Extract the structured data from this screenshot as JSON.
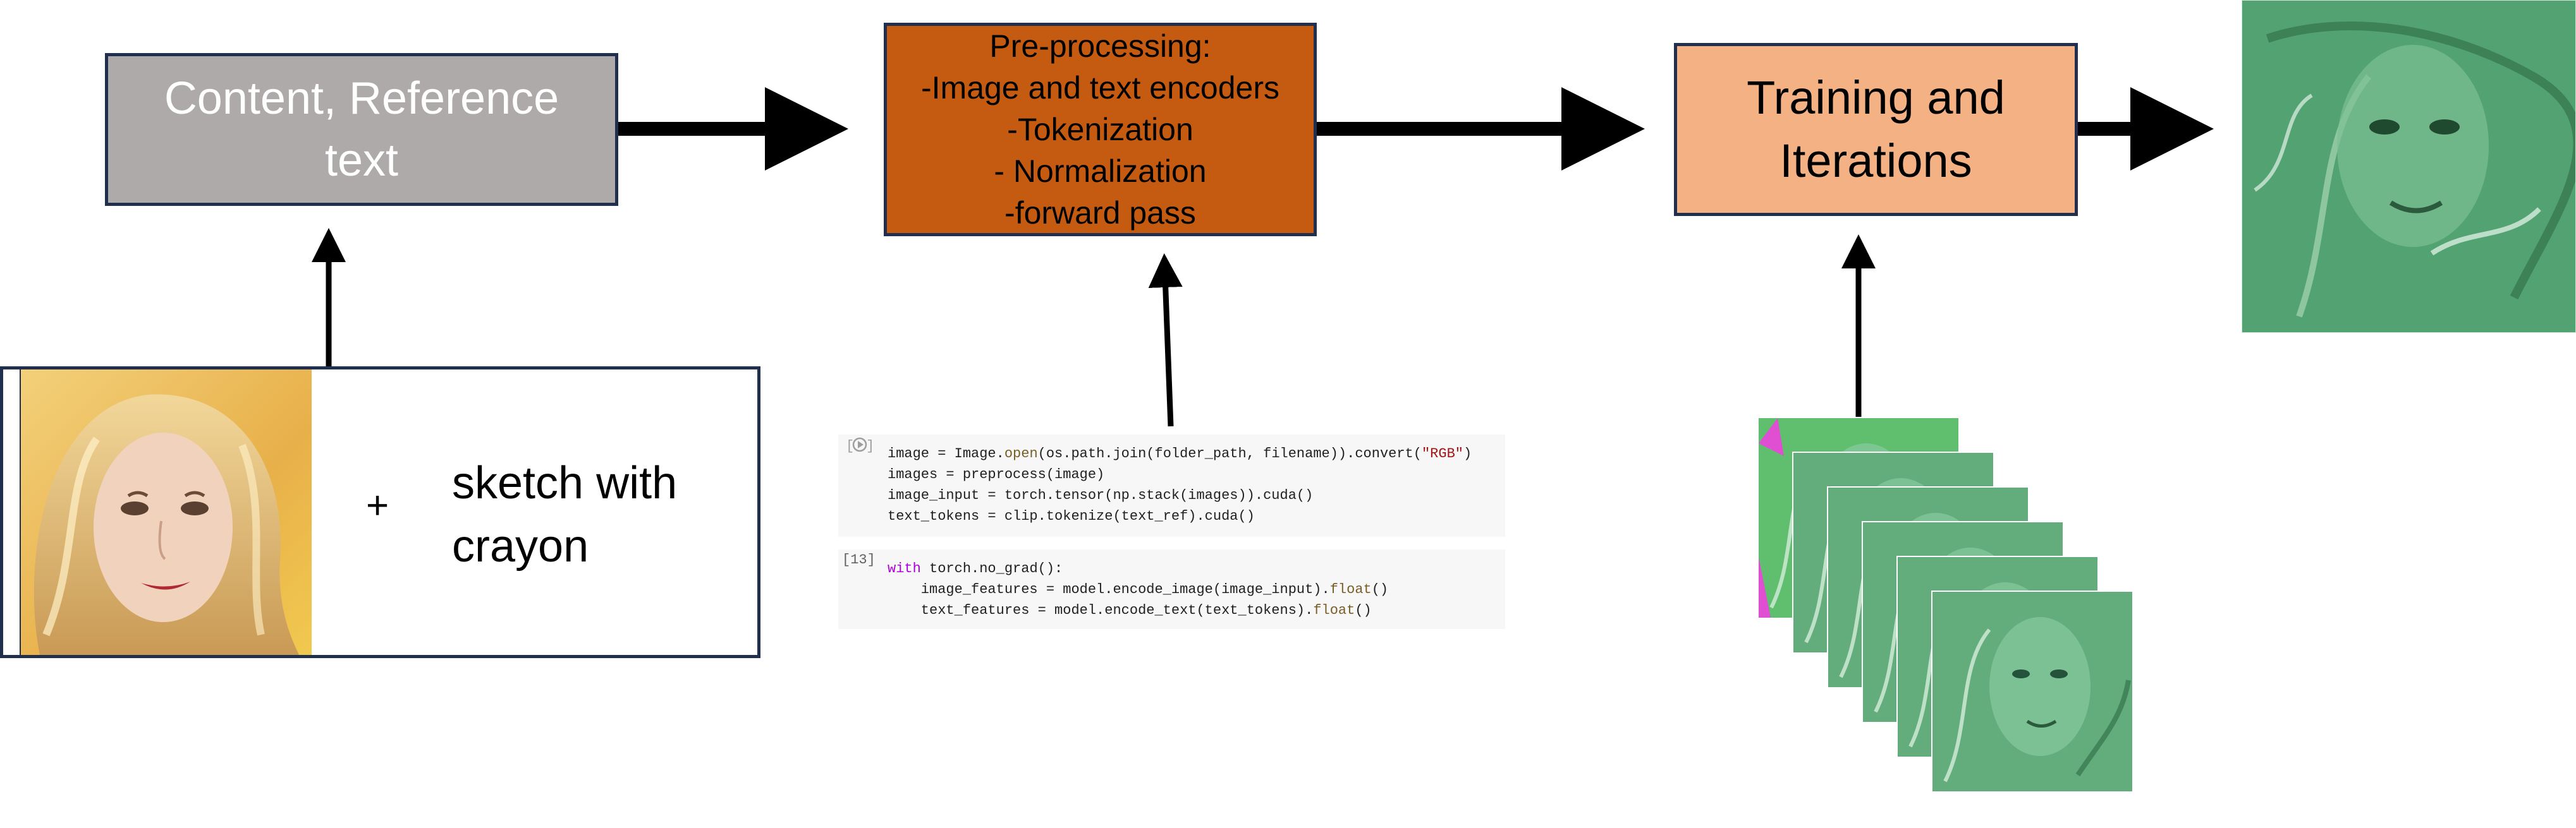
{
  "diagram": {
    "nodes": {
      "content_box": {
        "lines": [
          "Content, Reference",
          "text"
        ],
        "fill": "#aeaaaa",
        "text_color": "#ffffff"
      },
      "preprocess_box": {
        "lines": [
          "Pre-processing:",
          "-Image and text encoders",
          "-Tokenization",
          "- Normalization",
          "-forward pass"
        ],
        "fill": "#c55a11",
        "text_color": "#000000"
      },
      "training_box": {
        "lines": [
          "Training and",
          "Iterations"
        ],
        "fill": "#f4b183",
        "text_color": "#000000"
      }
    },
    "input_panel": {
      "plus": "+",
      "text_lines": [
        "sketch with",
        "crayon"
      ]
    },
    "code_cells": [
      {
        "execution_count": "",
        "lines": [
          [
            {
              "t": "image = Image.",
              "c": ""
            },
            {
              "t": "open",
              "c": "fn"
            },
            {
              "t": "(os.path.join(folder_path, filename)).convert(",
              "c": ""
            },
            {
              "t": "\"RGB\"",
              "c": "str"
            },
            {
              "t": ")",
              "c": ""
            }
          ],
          [
            {
              "t": "images = preprocess(image)",
              "c": ""
            }
          ],
          [
            {
              "t": "image_input = torch.tensor(np.stack(images)).cuda()",
              "c": ""
            }
          ],
          [
            {
              "t": "text_tokens = clip.tokenize(text_ref).cuda()",
              "c": ""
            }
          ]
        ]
      },
      {
        "execution_count": "[13]",
        "lines": [
          [
            {
              "t": "with",
              "c": "kw"
            },
            {
              "t": " torch.no_grad():",
              "c": ""
            }
          ],
          [
            {
              "t": "    image_features = model.encode_image(image_input).",
              "c": ""
            },
            {
              "t": "float",
              "c": "fn"
            },
            {
              "t": "()",
              "c": ""
            }
          ],
          [
            {
              "t": "    text_features = model.encode_text(text_tokens).",
              "c": ""
            },
            {
              "t": "float",
              "c": "fn"
            },
            {
              "t": "()",
              "c": ""
            }
          ]
        ]
      }
    ],
    "colors": {
      "arrow": "#000000",
      "border": "#1f2f4d",
      "stylized_green": "#5aa873"
    },
    "icons": [
      "run-cell-icon"
    ],
    "image_stack": {
      "count": 6
    }
  }
}
